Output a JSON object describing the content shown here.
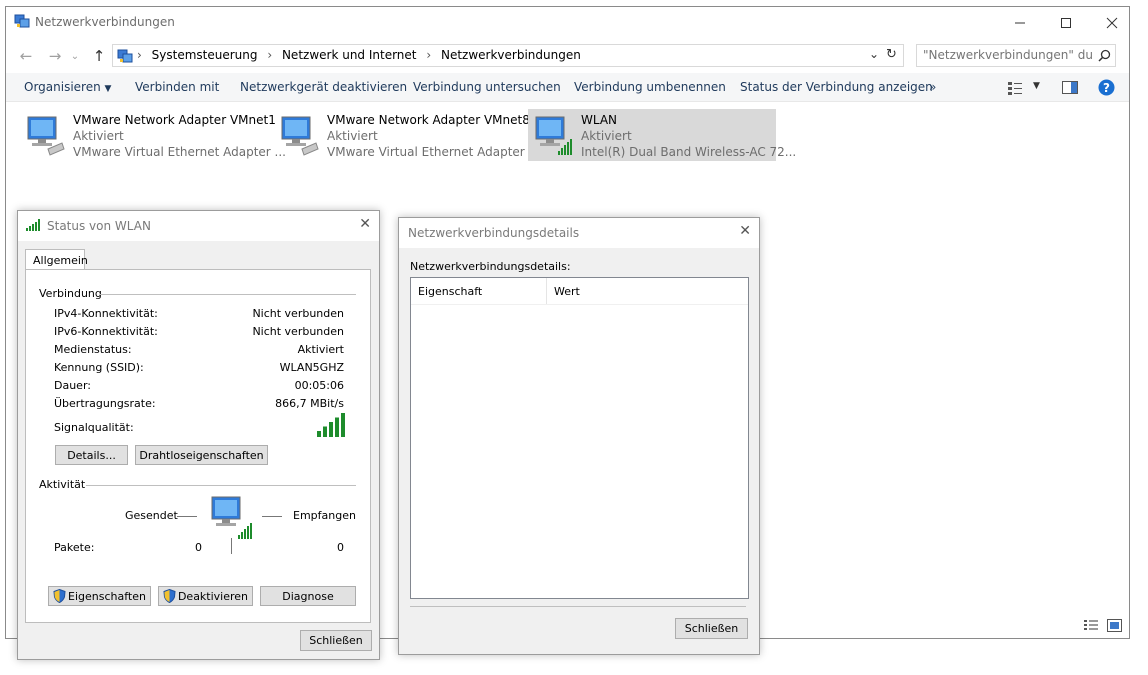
{
  "window": {
    "title": "Netzwerkverbindungen",
    "icon": "network-connections-icon"
  },
  "address": {
    "crumbs": [
      "Systemsteuerung",
      "Netzwerk und Internet",
      "Netzwerkverbindungen"
    ],
    "search_placeholder": "\"Netzwerkverbindungen\" dur..."
  },
  "toolbar": {
    "items": [
      "Organisieren",
      "Verbinden mit",
      "Netzwerkgerät deaktivieren",
      "Verbindung untersuchen",
      "Verbindung umbenennen",
      "Status der Verbindung anzeigen",
      "»"
    ]
  },
  "adapters": [
    {
      "name": "VMware Network Adapter VMnet1",
      "status": "Aktiviert",
      "device": "VMware Virtual Ethernet Adapter ...",
      "selected": false
    },
    {
      "name": "VMware Network Adapter VMnet8",
      "status": "Aktiviert",
      "device": "VMware Virtual Ethernet Adapter ...",
      "selected": false
    },
    {
      "name": "WLAN",
      "status": "Aktiviert",
      "device": "Intel(R) Dual Band Wireless-AC 72...",
      "selected": true
    }
  ],
  "status_dialog": {
    "title": "Status von WLAN",
    "tab": "Allgemein",
    "connection_group": "Verbindung",
    "rows": [
      {
        "label": "IPv4-Konnektivität:",
        "value": "Nicht verbunden"
      },
      {
        "label": "IPv6-Konnektivität:",
        "value": "Nicht verbunden"
      },
      {
        "label": "Medienstatus:",
        "value": "Aktiviert"
      },
      {
        "label": "Kennung (SSID):",
        "value": "WLAN5GHZ"
      },
      {
        "label": "Dauer:",
        "value": "00:05:06"
      },
      {
        "label": "Übertragungsrate:",
        "value": "866,7 MBit/s"
      }
    ],
    "signal_label": "Signalqualität:",
    "signal_bars": 5,
    "details_button": "Details...",
    "wireless_button": "Drahtloseigenschaften",
    "activity_group": "Aktivität",
    "sent_label": "Gesendet",
    "received_label": "Empfangen",
    "packets_label": "Pakete:",
    "packets_sent": "0",
    "packets_received": "0",
    "properties_button": "Eigenschaften",
    "deactivate_button": "Deaktivieren",
    "diagnose_button": "Diagnose",
    "close_button": "Schließen"
  },
  "details_dialog": {
    "title": "Netzwerkverbindungsdetails",
    "label": "Netzwerkverbindungsdetails:",
    "col_property": "Eigenschaft",
    "col_value": "Wert",
    "close_button": "Schließen"
  },
  "colors": {
    "toolbar_text": "#1e395b",
    "selection": "#d9d9d9",
    "signal_green": "#1e8c2c",
    "help_blue": "#1a6fd1"
  }
}
